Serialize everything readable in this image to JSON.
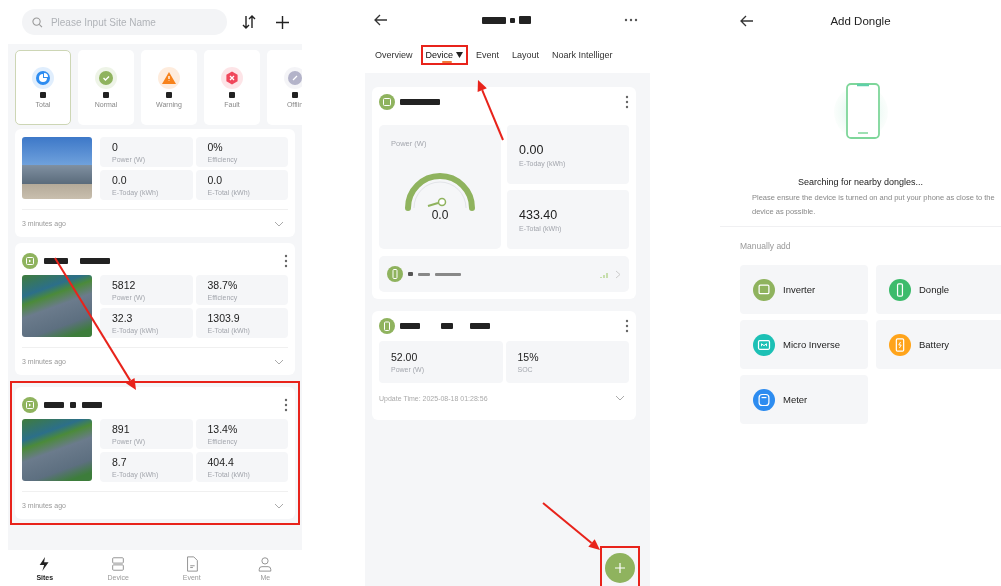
{
  "sites_screen": {
    "search": {
      "placeholder": "Please Input Site Name"
    },
    "status_filters": [
      {
        "kind": "total",
        "label": "Total",
        "selected": true
      },
      {
        "kind": "normal",
        "label": "Normal",
        "selected": false
      },
      {
        "kind": "warning",
        "label": "Warning",
        "selected": false
      },
      {
        "kind": "fault",
        "label": "Fault",
        "selected": false
      },
      {
        "kind": "offline",
        "label": "Offlin",
        "selected": false
      }
    ],
    "sites": [
      {
        "kind": "compact",
        "highlighted": false,
        "metrics": [
          {
            "value": "0",
            "label": "Power (W)"
          },
          {
            "value": "0%",
            "label": "Efficiency"
          },
          {
            "value": "0.0",
            "label": "E-Today (kWh)"
          },
          {
            "value": "0.0",
            "label": "E-Total (kWh)"
          }
        ],
        "updated": "3 minutes ago"
      },
      {
        "kind": "full",
        "highlighted": false,
        "metrics": [
          {
            "value": "5812",
            "label": "Power (W)"
          },
          {
            "value": "38.7%",
            "label": "Efficiency"
          },
          {
            "value": "32.3",
            "label": "E-Today (kWh)"
          },
          {
            "value": "1303.9",
            "label": "E-Total (kWh)"
          }
        ],
        "updated": "3 minutes ago"
      },
      {
        "kind": "full",
        "highlighted": true,
        "metrics": [
          {
            "value": "891",
            "label": "Power (W)"
          },
          {
            "value": "13.4%",
            "label": "Efficiency"
          },
          {
            "value": "8.7",
            "label": "E-Today (kWh)"
          },
          {
            "value": "404.4",
            "label": "E-Total (kWh)"
          }
        ],
        "updated": "3 minutes ago"
      }
    ],
    "nav": [
      {
        "kind": "sites",
        "label": "Sites",
        "selected": true
      },
      {
        "kind": "device",
        "label": "Device",
        "selected": false
      },
      {
        "kind": "event",
        "label": "Event",
        "selected": false
      },
      {
        "kind": "me",
        "label": "Me",
        "selected": false
      }
    ]
  },
  "device_screen": {
    "tabs": [
      {
        "label": "Overview",
        "selected": false,
        "highlighted": false,
        "dropdown": false
      },
      {
        "label": "Device",
        "selected": true,
        "highlighted": true,
        "dropdown": true
      },
      {
        "label": "Event",
        "selected": false,
        "highlighted": false,
        "dropdown": false
      },
      {
        "label": "Layout",
        "selected": false,
        "highlighted": false,
        "dropdown": false
      },
      {
        "label": "Noark Intelliger",
        "selected": false,
        "highlighted": false,
        "dropdown": false
      }
    ],
    "inverter": {
      "power_label": "Power  (W)",
      "power_value": "0.0",
      "metrics": [
        {
          "value": "0.00",
          "label": "E-Today  (kWh)"
        },
        {
          "value": "433.40",
          "label": "E-Total  (kWh)"
        }
      ]
    },
    "battery": {
      "metrics": [
        {
          "value": "52.00",
          "label": "Power (W)"
        },
        {
          "value": "15%",
          "label": "SOC"
        }
      ],
      "updated": "Update Time: 2025-08-18 01:28:56"
    },
    "add_button": {
      "highlighted": true
    }
  },
  "dongle_screen": {
    "title": "Add Dongle",
    "status": "Searching for nearby dongles...",
    "hint": "Please ensure the device is turned on and put your phone as close to the device as possible.",
    "section": "Manually add",
    "options": [
      {
        "kind": "inverter",
        "label": "Inverter",
        "color": "#8fb35e"
      },
      {
        "kind": "dongle",
        "label": "Dongle",
        "color": "#3dbb6c"
      },
      {
        "kind": "micro",
        "label": "Micro Inverse",
        "color": "#1cc0b5"
      },
      {
        "kind": "battery",
        "label": "Battery",
        "color": "#ffa41b"
      },
      {
        "kind": "meter",
        "label": "Meter",
        "color": "#2d8cf0"
      }
    ]
  }
}
